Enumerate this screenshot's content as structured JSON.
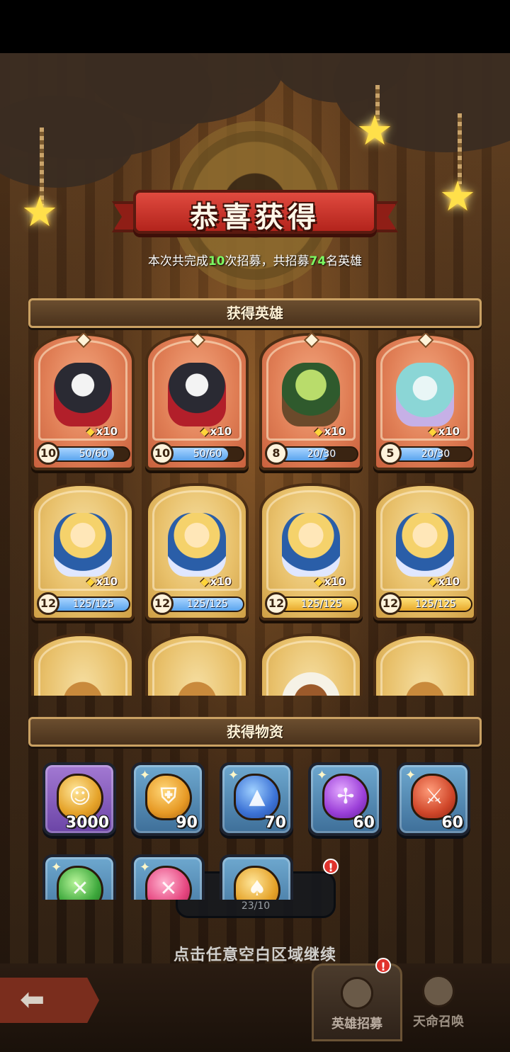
{
  "banner": {
    "title": "恭喜获得"
  },
  "summary": {
    "prefix": "本次共完成",
    "count": "10",
    "middle": "次招募，共招募",
    "heroes": "74",
    "suffix": "名英雄"
  },
  "hero_section": {
    "title": "获得英雄"
  },
  "heroes": [
    {
      "count": "x10",
      "level": "10",
      "progress": "50/60",
      "progress_fraction": 0.83,
      "rarity": "orange",
      "bar": "blue"
    },
    {
      "count": "x10",
      "level": "10",
      "progress": "50/60",
      "progress_fraction": 0.83,
      "rarity": "orange",
      "bar": "blue"
    },
    {
      "count": "x10",
      "level": "8",
      "progress": "20/30",
      "progress_fraction": 0.67,
      "rarity": "orange",
      "bar": "blue"
    },
    {
      "count": "x10",
      "level": "5",
      "progress": "20/30",
      "progress_fraction": 0.67,
      "rarity": "orange",
      "bar": "blue"
    },
    {
      "count": "x10",
      "level": "12",
      "progress": "125/125",
      "progress_fraction": 1.0,
      "rarity": "gold",
      "bar": "blue"
    },
    {
      "count": "x10",
      "level": "12",
      "progress": "125/125",
      "progress_fraction": 1.0,
      "rarity": "gold",
      "bar": "blue"
    },
    {
      "count": "x10",
      "level": "12",
      "progress": "125/125",
      "progress_fraction": 1.0,
      "rarity": "gold",
      "bar": "yellow"
    },
    {
      "count": "x10",
      "level": "12",
      "progress": "125/125",
      "progress_fraction": 1.0,
      "rarity": "gold",
      "bar": "yellow"
    }
  ],
  "item_section": {
    "title": "获得物资"
  },
  "items": [
    {
      "icon": "gold-coin-icon",
      "qty": "3000"
    },
    {
      "icon": "shield-rune-icon",
      "qty": "90"
    },
    {
      "icon": "blue-rune-icon",
      "qty": "70"
    },
    {
      "icon": "purple-rune-icon",
      "qty": "60"
    },
    {
      "icon": "red-rune-icon",
      "qty": "60"
    },
    {
      "icon": "green-rune-icon",
      "qty": ""
    },
    {
      "icon": "pink-rune-icon",
      "qty": ""
    },
    {
      "icon": "spade-coin-icon",
      "qty": ""
    }
  ],
  "cost_pill": {
    "text": "23/10",
    "badge": "!"
  },
  "continue_hint": "点击任意空白区域继续",
  "bottom_nav": {
    "tabs": [
      {
        "label": "英雄招募",
        "badge": "!"
      },
      {
        "label": "天命召唤"
      }
    ]
  }
}
